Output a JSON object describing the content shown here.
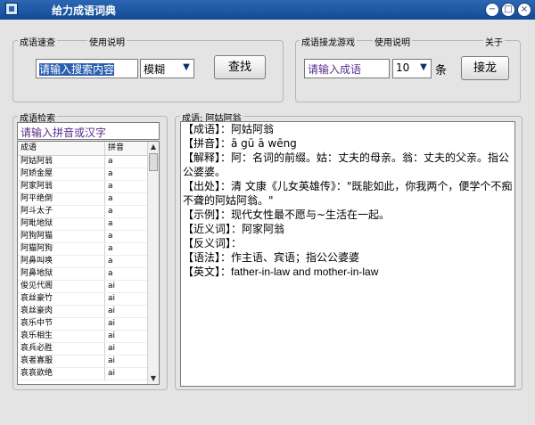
{
  "window": {
    "title": "给力成语词典",
    "minimize": "−",
    "maximize": "□",
    "close": "×"
  },
  "quick_search": {
    "group_label": "成语速查",
    "help_label": "使用说明",
    "input_value": "请输入搜索内容",
    "mode_value": "模糊",
    "search_button": "查找"
  },
  "solitaire": {
    "group_label": "成语接龙游戏",
    "help_label": "使用说明",
    "about_label": "关于",
    "input_value": "请输入成语",
    "count_value": "10",
    "unit": "条",
    "button": "接龙"
  },
  "search_panel": {
    "group_label": "成语检索",
    "filter_placeholder": "请输入拼音或汉字",
    "columns": [
      "成语",
      "拼音"
    ],
    "rows": [
      {
        "idiom": "阿姑阿翁",
        "pinyin": "a"
      },
      {
        "idiom": "阿娇金屋",
        "pinyin": "a"
      },
      {
        "idiom": "阿家阿翁",
        "pinyin": "a"
      },
      {
        "idiom": "阿平绝倒",
        "pinyin": "a"
      },
      {
        "idiom": "阿斗太子",
        "pinyin": "a"
      },
      {
        "idiom": "阿毗地狱",
        "pinyin": "a"
      },
      {
        "idiom": "阿狗阿猫",
        "pinyin": "a"
      },
      {
        "idiom": "阿猫阿狗",
        "pinyin": "a"
      },
      {
        "idiom": "阿鼻叫唤",
        "pinyin": "a"
      },
      {
        "idiom": "阿鼻地狱",
        "pinyin": "a"
      },
      {
        "idiom": "俊见代阁",
        "pinyin": "ai"
      },
      {
        "idiom": "哀丝豪竹",
        "pinyin": "ai"
      },
      {
        "idiom": "哀丝豪肉",
        "pinyin": "ai"
      },
      {
        "idiom": "哀乐中节",
        "pinyin": "ai"
      },
      {
        "idiom": "哀乐相生",
        "pinyin": "ai"
      },
      {
        "idiom": "哀兵必胜",
        "pinyin": "ai"
      },
      {
        "idiom": "哀者寡服",
        "pinyin": "ai"
      },
      {
        "idiom": "哀哀欲绝",
        "pinyin": "ai"
      }
    ]
  },
  "detail": {
    "group_label": "成语: 阿姑阿翁",
    "lines": [
      "【成语】：阿姑阿翁",
      "【拼音】：ā gū ā wēng",
      "【解释】：阿：名词的前缀。姑：丈夫的母亲。翁：丈夫的父亲。指公公婆婆。",
      "【出处】：清 文康《儿女英雄传》：\"既能如此，你我两个，便学个不痴不聋的阿姑阿翁。\"",
      "【示例】：现代女性最不愿与~生活在一起。",
      "【近义词】：阿家阿翁",
      "【反义词】：",
      "【语法】：作主语、宾语；指公公婆婆",
      "【英文】：father-in-law and mother-in-law"
    ]
  }
}
